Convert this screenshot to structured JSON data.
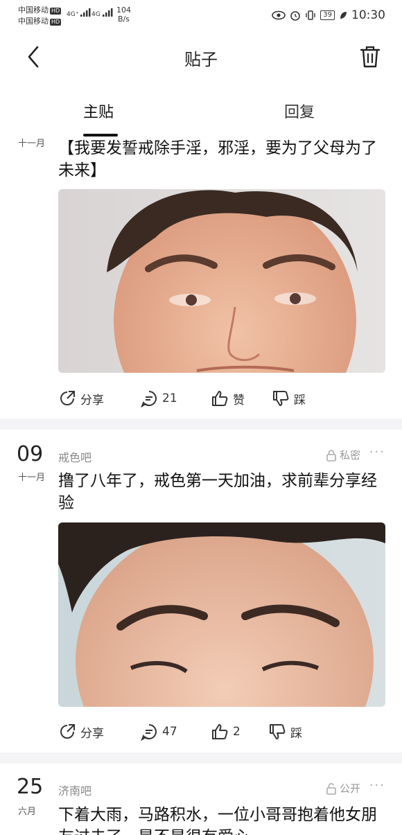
{
  "status": {
    "carrier1": "中国移动",
    "carrier2": "中国移动",
    "hd": "HD",
    "net1": "4G⁺",
    "net2": "4G",
    "speed_value": "104",
    "speed_unit": "B/s",
    "battery": "39",
    "time": "10:30"
  },
  "header": {
    "title": "贴子"
  },
  "tabs": {
    "main": "主贴",
    "reply": "回复"
  },
  "posts": [
    {
      "day": "",
      "month": "十一月",
      "forum": "",
      "privacy": "",
      "title": "【我要发誓戒除手淫，邪淫，要为了父母为了未来】",
      "share": "分享",
      "comments": "21",
      "like": "赞",
      "dislike": "踩"
    },
    {
      "day": "09",
      "month": "十一月",
      "forum": "戒色吧",
      "privacy": "私密",
      "more": "···",
      "title": "撸了八年了，戒色第一天加油，求前辈分享经验",
      "share": "分享",
      "comments": "47",
      "like": "2",
      "dislike": "踩"
    },
    {
      "day": "25",
      "month": "六月",
      "forum": "济南吧",
      "privacy": "公开",
      "more": "···",
      "title": "下着大雨，马路积水，一位小哥哥抱着他女朋友过去了，是不是很有爱心"
    }
  ],
  "icons": {
    "back": "chevron-left-icon",
    "trash": "trash-icon",
    "share": "share-icon",
    "comment": "comment-icon",
    "like": "thumbs-up-icon",
    "dislike": "thumbs-down-icon",
    "lock": "lock-icon",
    "unlock": "unlock-icon"
  }
}
